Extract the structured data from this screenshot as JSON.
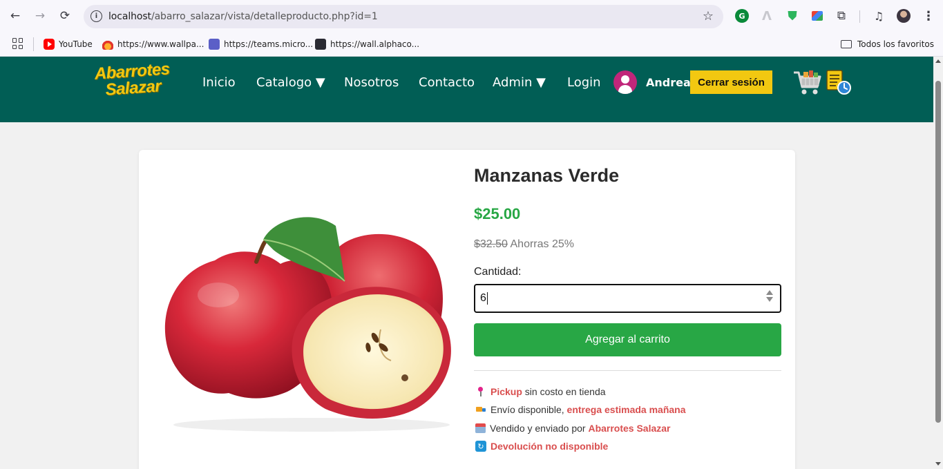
{
  "browser": {
    "url_host": "localhost",
    "url_path": "/abarro_salazar/vista/detalleproducto.php?id=1",
    "bookmarks": [
      {
        "label": "YouTube",
        "icon": "youtube-icon"
      },
      {
        "label": "https://www.wallpa...",
        "icon": "fire-icon"
      },
      {
        "label": "https://teams.micro...",
        "icon": "teams-icon"
      },
      {
        "label": "https://wall.alphaco...",
        "icon": "wall-icon"
      }
    ],
    "favorites_folder": "Todos los favoritos",
    "extension_g_label": "G"
  },
  "site": {
    "logo": {
      "line1": "Abarrotes",
      "line2": "Salazar"
    },
    "nav": {
      "inicio": "Inicio",
      "catalogo": "Catalogo ▼",
      "nosotros": "Nosotros",
      "contacto": "Contacto",
      "admin": "Admin ▼",
      "login": "Login"
    },
    "user_name": "Andrea",
    "logout_label": "Cerrar sesión",
    "colors": {
      "header": "#015e55",
      "accent_yellow": "#f2c811",
      "green": "#28a745",
      "highlight_red": "#d94e4e"
    }
  },
  "product": {
    "title": "Manzanas Verde",
    "price": "$25.00",
    "old_price": "$32.50",
    "savings": "Ahorras 25%",
    "quantity_label": "Cantidad:",
    "quantity_value": "6",
    "add_to_cart_label": "Agregar al carrito",
    "info": {
      "pickup_hl": "Pickup",
      "pickup_rest": "sin costo en tienda",
      "shipping_pre": "Envío disponible,",
      "shipping_hl": "entrega estimada mañana",
      "sold_pre": "Vendido y enviado por",
      "sold_hl": "Abarrotes Salazar",
      "returns_hl": "Devolución no disponible"
    }
  }
}
